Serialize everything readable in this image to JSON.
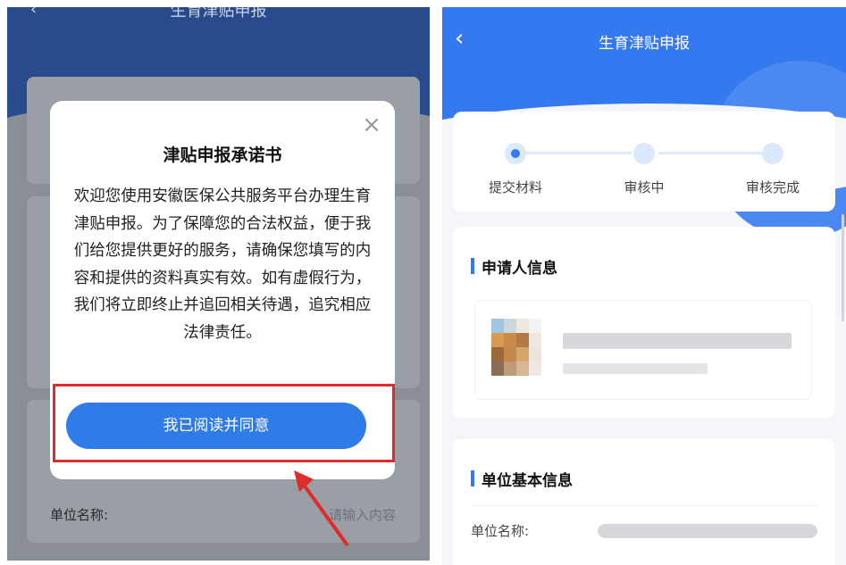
{
  "left": {
    "top_title": "生育津贴申报",
    "background": {
      "unit_label": "单位名称:",
      "unit_placeholder": "请输入内容"
    },
    "modal": {
      "title": "津贴申报承诺书",
      "body": "欢迎您使用安徽医保公共服务平台办理生育津贴申报。为了保障您的合法权益，便于我们给您提供更好的服务，请确保您填写的内容和提供的资料真实有效。如有虚假行为，我们将立即终止并追回相关待遇，追究相应法律责任。",
      "close_icon": "close-icon",
      "agree_button": "我已阅读并同意"
    },
    "highlight_color": "#e02b2b"
  },
  "right": {
    "title": "生育津贴申报",
    "back_icon": "chevron-left-icon",
    "steps": [
      {
        "label": "提交材料",
        "active": true
      },
      {
        "label": "审核中",
        "active": false
      },
      {
        "label": "审核完成",
        "active": false
      }
    ],
    "applicant_section": {
      "title": "申请人信息"
    },
    "unit_section": {
      "title": "单位基本信息",
      "unit_label": "单位名称:"
    },
    "accent_color": "#3479f0"
  }
}
